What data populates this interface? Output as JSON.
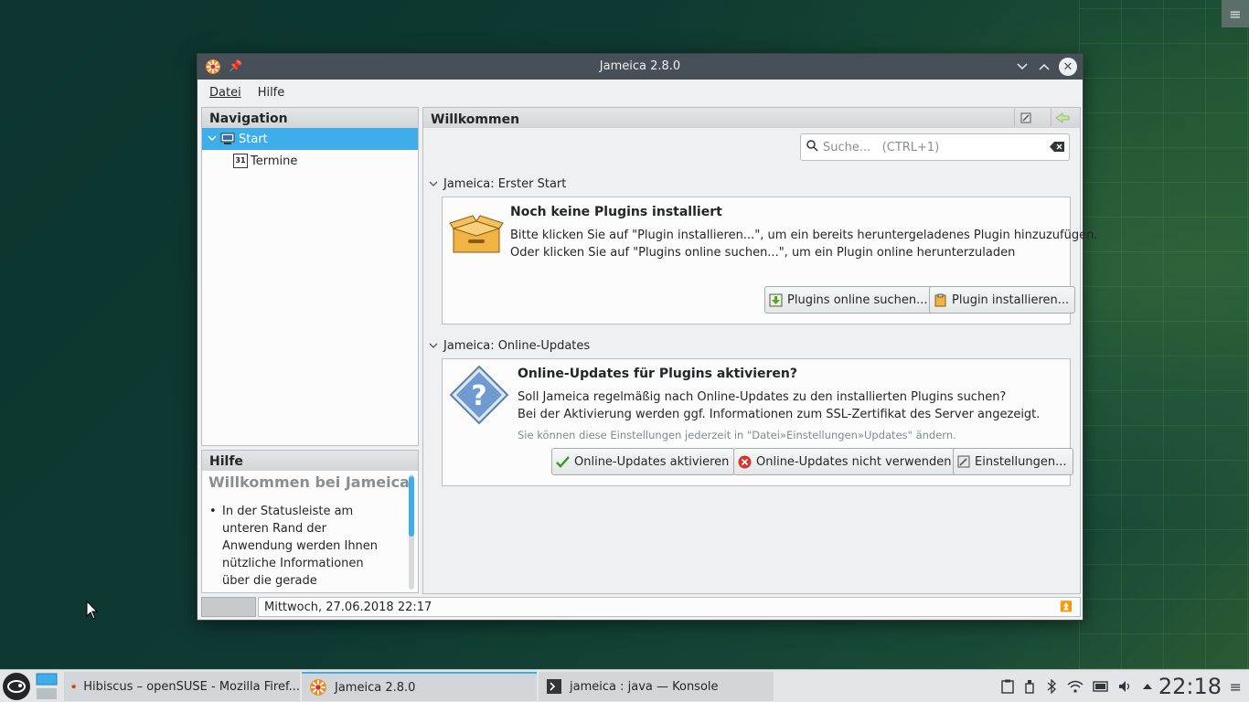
{
  "window": {
    "title": "Jameica 2.8.0",
    "menu": [
      "Datei",
      "Hilfe"
    ]
  },
  "navigation": {
    "header": "Navigation",
    "items": [
      {
        "label": "Start",
        "selected": true,
        "expanded": true
      },
      {
        "label": "Termine",
        "icon_text": "31"
      }
    ]
  },
  "help": {
    "header": "Hilfe",
    "title": "Willkommen bei Jameica.",
    "bullet": "In der Statusleiste am unteren Rand der Anwendung werden Ihnen nützliche Informationen über die gerade ausgeführten Anweisungen angezeigt."
  },
  "main": {
    "header": "Willkommen",
    "search_placeholder": "Suche...   (CTRL+1)",
    "section1": {
      "title": "Jameica: Erster Start",
      "heading": "Noch keine Plugins installiert",
      "line1": "Bitte klicken Sie auf \"Plugin installieren...\", um ein bereits heruntergeladenes Plugin hinzuzufügen.",
      "line2": "Oder klicken Sie auf \"Plugins online suchen...\", um ein Plugin online herunterzuladen",
      "btn_online": "Plugins online suchen...",
      "btn_install": "Plugin installieren..."
    },
    "section2": {
      "title": "Jameica: Online-Updates",
      "heading": "Online-Updates für Plugins aktivieren?",
      "line1": "Soll Jameica regelmäßig nach Online-Updates zu den installierten Plugins suchen?",
      "line2": "Bei der Aktivierung werden ggf. Informationen zum SSL-Zertifikat des Server angezeigt.",
      "note": "Sie können diese Einstellungen jederzeit in \"Datei»Einstellungen»Updates\" ändern.",
      "btn_enable": "Online-Updates aktivieren",
      "btn_disable": "Online-Updates nicht verwenden",
      "btn_settings": "Einstellungen..."
    }
  },
  "statusbar": {
    "text": "Mittwoch, 27.06.2018 22:17"
  },
  "taskbar": {
    "tasks": [
      {
        "label": "Hibiscus – openSUSE - Mozilla Firef...",
        "icon": "firefox-icon"
      },
      {
        "label": "Jameica 2.8.0",
        "icon": "jameica-icon",
        "active": true
      },
      {
        "label": "jameica : java — Konsole",
        "icon": "terminal-icon"
      }
    ],
    "clock": "22:18"
  },
  "colors": {
    "accent": "#3daee9",
    "titlebar": "#475057",
    "desktop": "#0f3a33"
  }
}
